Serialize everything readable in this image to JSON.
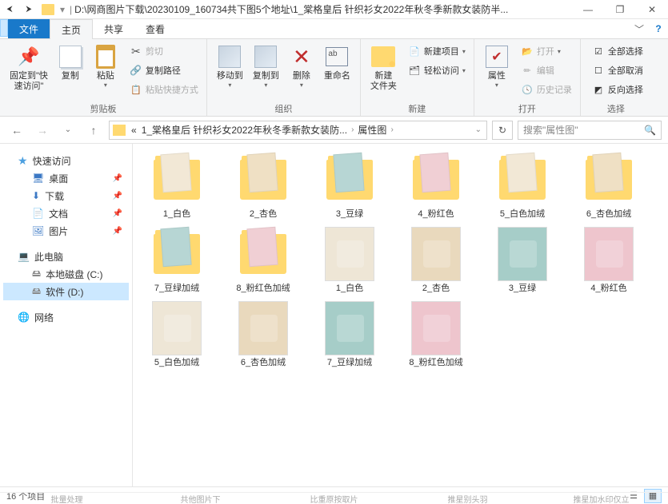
{
  "title_path": "D:\\网商图片下载\\20230109_160734共下图5个地址\\1_棠格皇后 针织衫女2022年秋冬季新款女装防半...",
  "win": {
    "min": "—",
    "max": "❐",
    "close": "✕"
  },
  "menu": {
    "file": "文件",
    "home": "主页",
    "share": "共享",
    "view": "查看",
    "chev": "﹀",
    "help": "?"
  },
  "ribbon": {
    "pin": {
      "label": "固定到\"快\n速访问\""
    },
    "copy": "复制",
    "paste": "粘贴",
    "cut": "剪切",
    "copypath": "复制路径",
    "pasteshortcut": "粘贴快捷方式",
    "clipboard": "剪贴板",
    "moveto": "移动到",
    "copyto": "复制到",
    "delete": "删除",
    "rename": "重命名",
    "organize": "组织",
    "newfolder": "新建\n文件夹",
    "newitem": "新建项目",
    "easyaccess": "轻松访问",
    "new": "新建",
    "properties": "属性",
    "open_btn": "打开",
    "edit": "编辑",
    "history": "历史记录",
    "open_group": "打开",
    "selectall": "全部选择",
    "selectnone": "全部取消",
    "invert": "反向选择",
    "select": "选择"
  },
  "address": {
    "back": "←",
    "fwd": "→",
    "dd": "⌄",
    "up": "↑",
    "crumb1": "«",
    "crumb2": "1_棠格皇后 针织衫女2022年秋冬季新款女装防...",
    "crumb3": "属性图",
    "refresh": "↻",
    "search_ph": "搜索\"属性图\"",
    "search_icon": "🔍"
  },
  "sidebar": {
    "quick": "快速访问",
    "desktop": "桌面",
    "downloads": "下载",
    "documents": "文档",
    "pictures": "图片",
    "thispc": "此电脑",
    "diskc": "本地磁盘 (C:)",
    "diskd": "软件 (D:)",
    "network": "网络"
  },
  "files": {
    "folders": [
      {
        "label": "1_白色",
        "c": "#f2e8d6"
      },
      {
        "label": "2_杏色",
        "c": "#efe0c4"
      },
      {
        "label": "3_豆绿",
        "c": "#b7d6d4"
      },
      {
        "label": "4_粉红色",
        "c": "#f0cfd4"
      },
      {
        "label": "5_白色加绒",
        "c": "#f2e8d6"
      },
      {
        "label": "6_杏色加绒",
        "c": "#efe0c4"
      },
      {
        "label": "7_豆绿加绒",
        "c": "#b7d6d4"
      },
      {
        "label": "8_粉红色加绒",
        "c": "#f0cfd4"
      }
    ],
    "images": [
      {
        "label": "1_白色",
        "c": "#eee6d6"
      },
      {
        "label": "2_杏色",
        "c": "#e9d9bd"
      },
      {
        "label": "3_豆绿",
        "c": "#a6cdc8"
      },
      {
        "label": "4_粉红色",
        "c": "#eec5cd"
      },
      {
        "label": "5_白色加绒",
        "c": "#eee6d6"
      },
      {
        "label": "6_杏色加绒",
        "c": "#e9d9bd"
      },
      {
        "label": "7_豆绿加绒",
        "c": "#a6cdc8"
      },
      {
        "label": "8_粉红色加绒",
        "c": "#eec5cd"
      }
    ]
  },
  "status": {
    "count": "16 个项目"
  },
  "bottom_tabs": [
    "批量处理",
    "共他图片下",
    "比重原按取片",
    "推星别头羽",
    "推星加水印仅立"
  ]
}
